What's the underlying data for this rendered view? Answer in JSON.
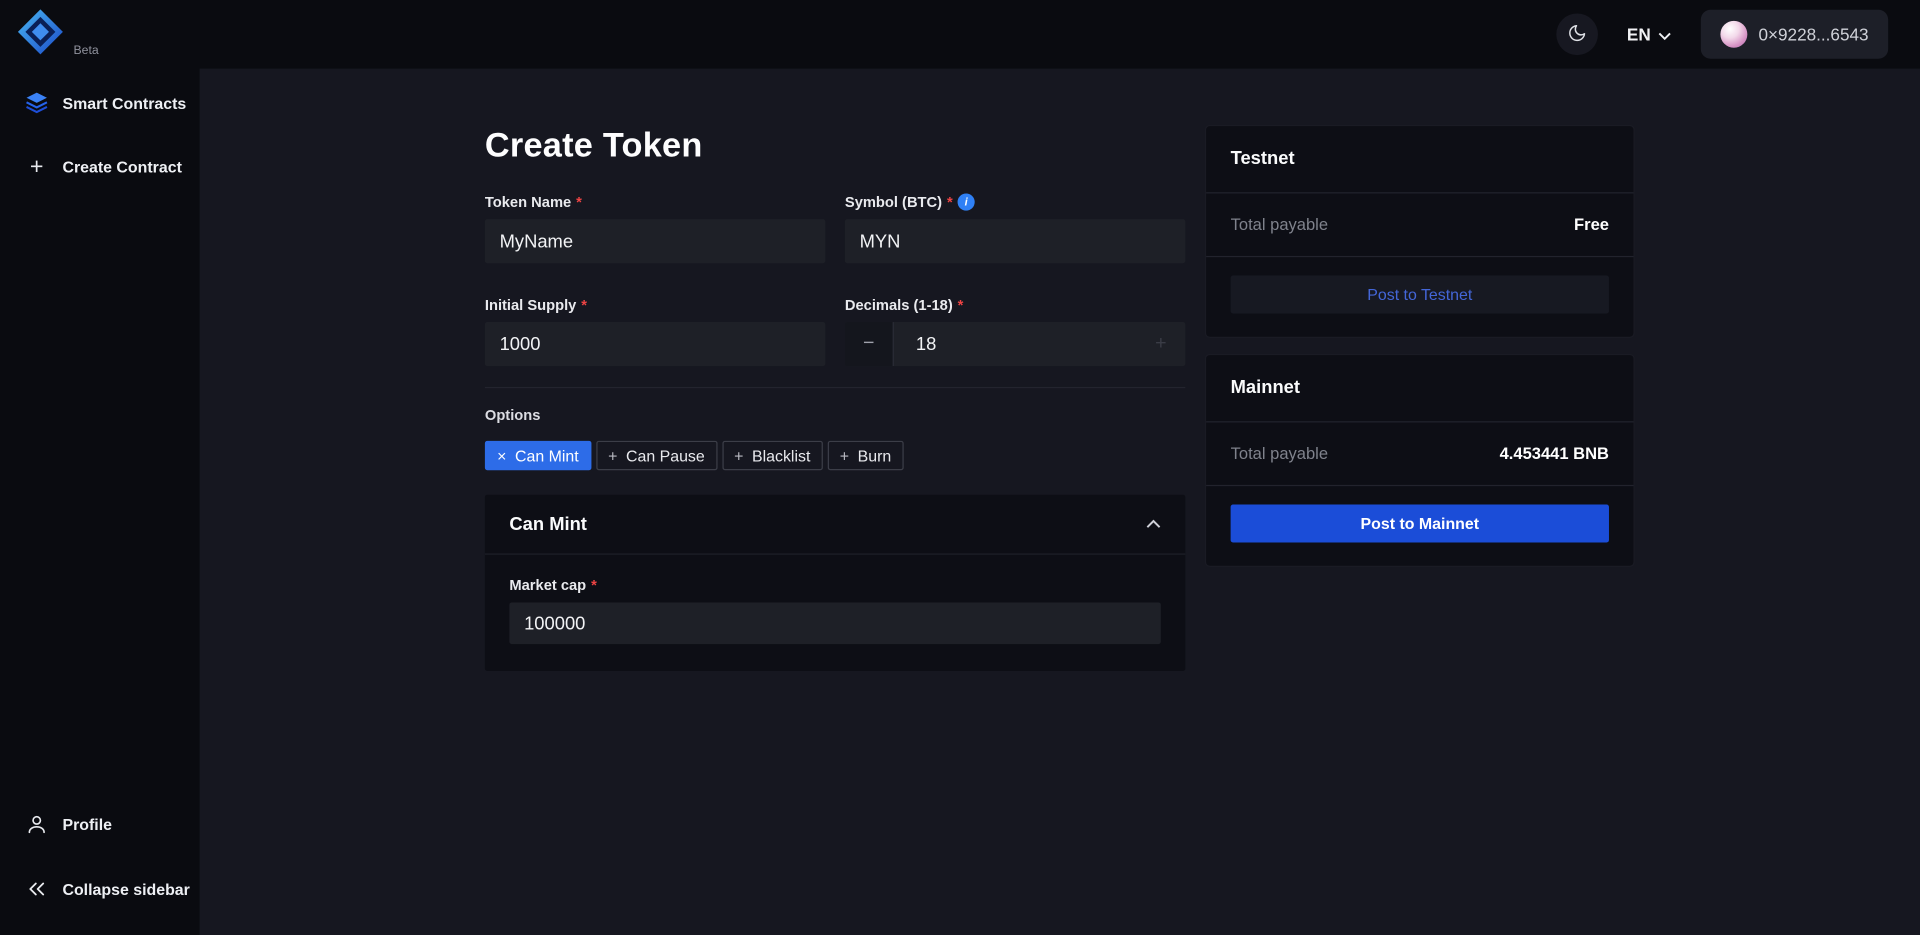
{
  "topbar": {
    "beta_label": "Beta",
    "language_label": "EN",
    "wallet": {
      "address": "0×9228...6543"
    }
  },
  "sidebar": {
    "items": [
      {
        "label": "Smart Contracts"
      },
      {
        "label": "Create Contract"
      }
    ],
    "bottom_items": [
      {
        "label": "Profile"
      },
      {
        "label": "Collapse sidebar"
      }
    ]
  },
  "main": {
    "title": "Create Token",
    "form": {
      "token_name": {
        "label": "Token Name",
        "value": "MyName"
      },
      "symbol": {
        "label": "Symbol (BTC)",
        "value": "MYN"
      },
      "initial_supply": {
        "label": "Initial Supply",
        "value": "1000"
      },
      "decimals": {
        "label": "Decimals (1-18)",
        "value": "18"
      },
      "options_label": "Options",
      "chips": [
        {
          "label": "Can Mint",
          "icon": "×",
          "selected": true
        },
        {
          "label": "Can Pause",
          "icon": "+",
          "selected": false
        },
        {
          "label": "Blacklist",
          "icon": "+",
          "selected": false
        },
        {
          "label": "Burn",
          "icon": "+",
          "selected": false
        }
      ]
    },
    "can_mint_panel": {
      "title": "Can Mint",
      "market_cap": {
        "label": "Market cap",
        "value": "100000"
      }
    }
  },
  "right_panel": {
    "cards": [
      {
        "title": "Testnet",
        "payable_label": "Total payable",
        "payable_value": "Free",
        "button": "Post to Testnet"
      },
      {
        "title": "Mainnet",
        "payable_label": "Total payable",
        "payable_value": "4.453441 BNB",
        "button": "Post to Mainnet"
      }
    ]
  },
  "glyphs": {
    "required": "*",
    "minus": "−",
    "plus": "+"
  },
  "colors": {
    "accent_blue": "#1b4dd8",
    "chip_selected_blue": "#2d6ce8",
    "required_red": "#ef4444",
    "info_blue": "#2f80f5",
    "background": "#161720",
    "panel_background": "#0d0e15"
  }
}
